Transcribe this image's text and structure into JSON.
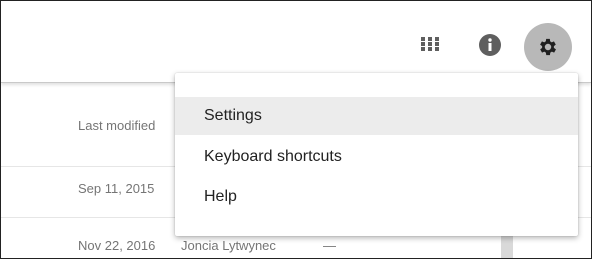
{
  "toolbar": {
    "icons": [
      "apps-icon",
      "info-icon",
      "gear-icon"
    ]
  },
  "table": {
    "header_last_modified": "Last modified",
    "rows": [
      {
        "date": "Sep 11, 2015",
        "owner": "",
        "size": ""
      },
      {
        "date": "Nov 22, 2016",
        "owner": "Joncia Lytwynec",
        "size": "—"
      }
    ]
  },
  "settings_menu": {
    "items": [
      {
        "label": "Settings",
        "active": true
      },
      {
        "label": "Keyboard shortcuts",
        "active": false
      },
      {
        "label": "Help",
        "active": false
      }
    ]
  },
  "colors": {
    "gear_button_bg": "#b8b8b8",
    "menu_hover_bg": "#ececec",
    "icon_gray": "#5f5f5f"
  }
}
